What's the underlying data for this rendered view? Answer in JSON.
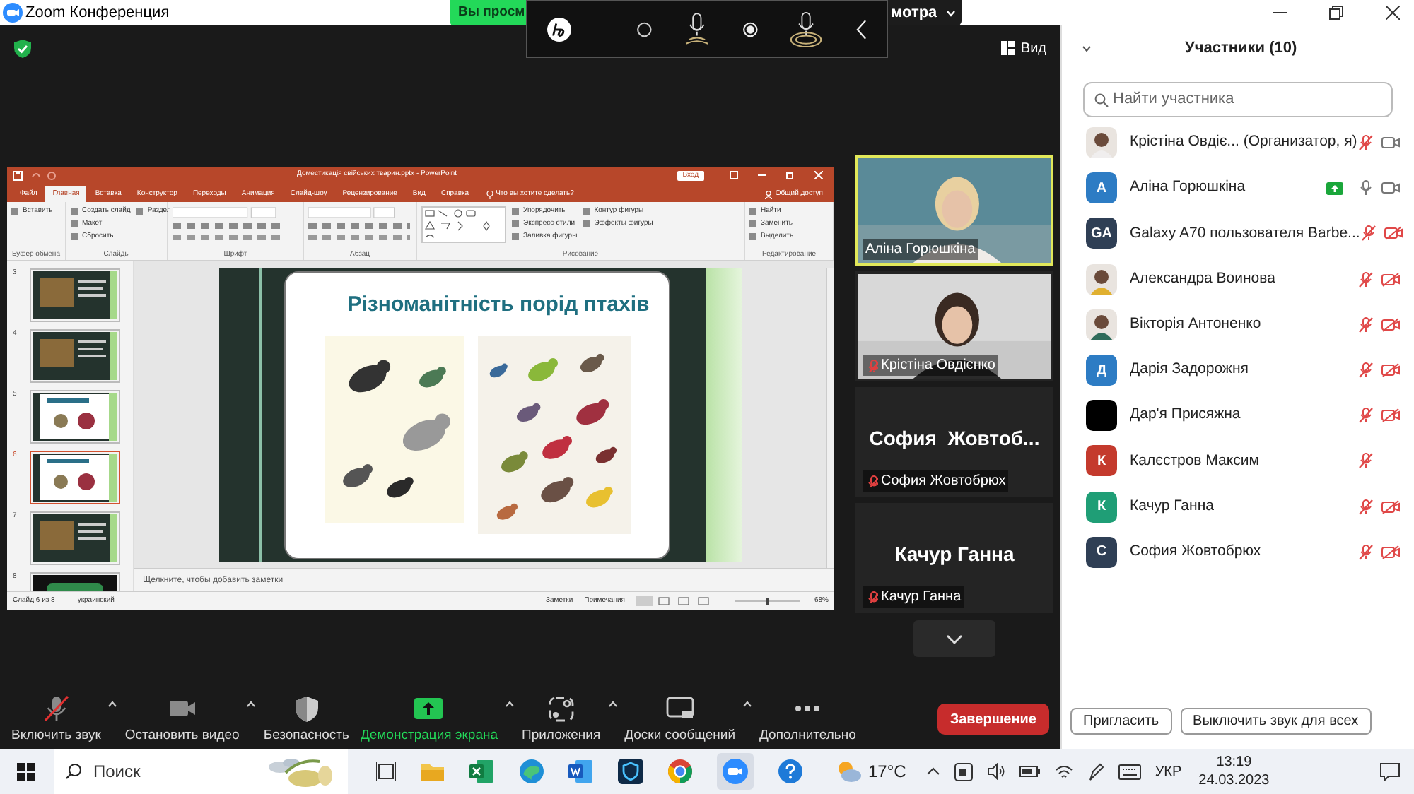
{
  "window": {
    "title": "Zoom Конференция"
  },
  "view_banner": {
    "left": "Вы просм",
    "right": "мотра"
  },
  "view_button": "Вид",
  "powerpoint": {
    "title": "Доместикація свійських тварин.pptx - PowerPoint",
    "sign_in": "Вход",
    "tell_me": "Что вы хотите сделать?",
    "share": "Общий доступ",
    "tabs": [
      {
        "label": "Файл",
        "selected": false
      },
      {
        "label": "Главная",
        "selected": true
      },
      {
        "label": "Вставка",
        "selected": false
      },
      {
        "label": "Конструктор",
        "selected": false
      },
      {
        "label": "Переходы",
        "selected": false
      },
      {
        "label": "Анимация",
        "selected": false
      },
      {
        "label": "Слайд-шоу",
        "selected": false
      },
      {
        "label": "Рецензирование",
        "selected": false
      },
      {
        "label": "Вид",
        "selected": false
      },
      {
        "label": "Справка",
        "selected": false
      }
    ],
    "ribbon_groups": [
      {
        "label": "Буфер обмена",
        "buttons": [
          "Вставить"
        ]
      },
      {
        "label": "Слайды",
        "buttons": [
          "Создать слайд",
          "Макет",
          "Сбросить",
          "Раздел"
        ]
      },
      {
        "label": "Шрифт"
      },
      {
        "label": "Абзац"
      },
      {
        "label": "Рисование",
        "buttons": [
          "Упорядочить",
          "Экспресс-стили",
          "Заливка фигуры",
          "Контур фигуры",
          "Эффекты фигуры"
        ]
      },
      {
        "label": "Редактирование",
        "buttons": [
          "Найти",
          "Заменить",
          "Выделить"
        ]
      }
    ],
    "slides": [
      {
        "number": "3",
        "selected": false,
        "kind": "dark"
      },
      {
        "number": "4",
        "selected": false,
        "kind": "dark"
      },
      {
        "number": "5",
        "selected": false,
        "kind": "light"
      },
      {
        "number": "6",
        "selected": true,
        "kind": "light"
      },
      {
        "number": "7",
        "selected": false,
        "kind": "dark"
      },
      {
        "number": "8",
        "selected": false,
        "kind": "black"
      }
    ],
    "slide_title": "Різноманітність порід птахів",
    "notes_placeholder": "Щелкните, чтобы добавить заметки",
    "status": {
      "slide": "Слайд 6 из 8",
      "language": "украинский",
      "notes": "Заметки",
      "comments": "Примечания",
      "zoom": "68%"
    }
  },
  "video_tiles": [
    {
      "kind": "video",
      "name": "Аліна Горюшкіна",
      "speaking": true,
      "muted": false
    },
    {
      "kind": "video",
      "name": "Крістіна Овдієнко",
      "speaking": false,
      "muted": true
    },
    {
      "kind": "name",
      "display": "София  Жовтоб...",
      "name": "София Жовтобрюх",
      "speaking": false,
      "muted": true
    },
    {
      "kind": "name",
      "display": "Качур Ганна",
      "name": "Качур Ганна",
      "speaking": false,
      "muted": true
    }
  ],
  "participants": {
    "title": "Участники (10)",
    "search_placeholder": "Найти участника",
    "items": [
      {
        "name": "Крістіна Овдіє... (Организатор, я)",
        "sharing": false,
        "muted": true,
        "camera_shown": true,
        "video_on": true
      },
      {
        "name": "Аліна Горюшкіна",
        "kind": "initials",
        "initials": "A",
        "color": "#2d7cc4",
        "sharing": true,
        "muted": false,
        "camera_shown": true,
        "video_on": true
      },
      {
        "name": "Galaxy A70 пользователя Barbe...",
        "kind": "initials",
        "initials": "GA",
        "color": "#2f3f55",
        "sharing": false,
        "muted": true,
        "camera_shown": true,
        "video_on": false
      },
      {
        "name": "Александра Воинова",
        "sharing": false,
        "muted": true,
        "camera_shown": true,
        "video_on": false
      },
      {
        "name": "Вікторія Антоненко",
        "sharing": false,
        "muted": true,
        "camera_shown": true,
        "video_on": false
      },
      {
        "name": "Дарія Задорожня",
        "kind": "initials",
        "initials": "Д",
        "color": "#2d7cc4",
        "sharing": false,
        "muted": true,
        "camera_shown": true,
        "video_on": false
      },
      {
        "name": "Дар'я Присяжна",
        "kind": "plain",
        "color": "#000000",
        "sharing": false,
        "muted": true,
        "camera_shown": true,
        "video_on": false
      },
      {
        "name": "Калєстров Максим",
        "kind": "initials",
        "initials": "К",
        "color": "#c43a2d",
        "sharing": false,
        "muted": true,
        "camera_shown": false
      },
      {
        "name": "Качур Ганна",
        "kind": "initials",
        "initials": "К",
        "color": "#1f9e76",
        "sharing": false,
        "muted": true,
        "camera_shown": true,
        "video_on": false
      },
      {
        "name": "София Жовтобрюх",
        "kind": "initials",
        "initials": "С",
        "color": "#2f3f55",
        "sharing": false,
        "muted": true,
        "camera_shown": true,
        "video_on": false
      }
    ],
    "buttons": [
      "Пригласить",
      "Выключить звук для всех"
    ]
  },
  "toolbar": [
    {
      "label": "Включить звук",
      "caret": true,
      "active": false
    },
    {
      "label": "Остановить видео",
      "caret": true,
      "active": false
    },
    {
      "label": "Безопасность",
      "caret": false,
      "active": false
    },
    {
      "label": "Демонстрация экрана",
      "caret": true,
      "active": true
    },
    {
      "label": "Приложения",
      "caret": true,
      "active": false
    },
    {
      "label": "Доски сообщений",
      "caret": true,
      "active": false
    },
    {
      "label": "Дополнительно",
      "caret": false,
      "active": false
    }
  ],
  "end_button": "Завершение",
  "taskbar": {
    "search_placeholder": "Поиск",
    "weather": "17°C",
    "language": "УКР",
    "time": "13:19",
    "date": "24.03.2023"
  }
}
